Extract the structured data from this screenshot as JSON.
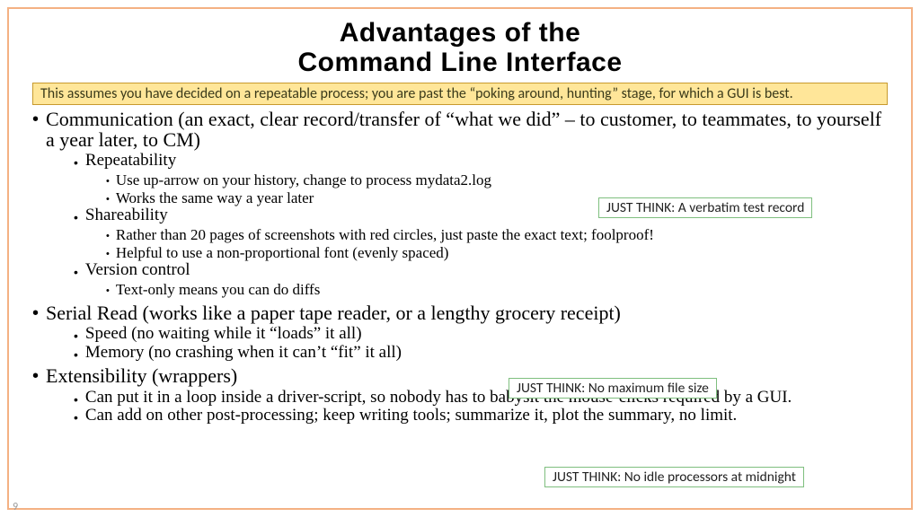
{
  "title_line1": "Advantages of the",
  "title_line2": "Command Line Interface",
  "banner": "This assumes you have decided on a repeatable process; you are past the “poking around, hunting” stage, for which a GUI is best.",
  "b1": {
    "text": "Communication (an exact, clear record/transfer of “what we did” – to customer, to teammates, to yourself a year later, to CM)",
    "sub": {
      "repeat": {
        "label": "Repeatability",
        "i1": "Use up-arrow on your history, change to process mydata2.log",
        "i2": "Works the same way a year later"
      },
      "share": {
        "label": "Shareability",
        "i1": "Rather than 20 pages of screenshots with red circles, just paste the exact text; foolproof!",
        "i2": "Helpful to use a non-proportional font (evenly spaced)"
      },
      "version": {
        "label": "Version control",
        "i1": "Text-only means you can do diffs"
      }
    }
  },
  "b2": {
    "text": "Serial Read (works like a paper tape reader, or a lengthy grocery receipt)",
    "sub": {
      "i1": "Speed (no waiting while it “loads” it all)",
      "i2": "Memory (no crashing when it can’t “fit” it all)"
    }
  },
  "b3": {
    "text": "Extensibility (wrappers)",
    "sub": {
      "i1": "Can put it in a loop inside a driver-script, so nobody has to babysit the mouse-clicks required by a GUI.",
      "i2": "Can add on other post-processing; keep writing tools; summarize it, plot the summary, no limit."
    }
  },
  "callout1": "JUST THINK: A verbatim test record",
  "callout2": "JUST THINK: No maximum file size",
  "callout3": "JUST THINK: No idle processors at midnight",
  "page": "9"
}
